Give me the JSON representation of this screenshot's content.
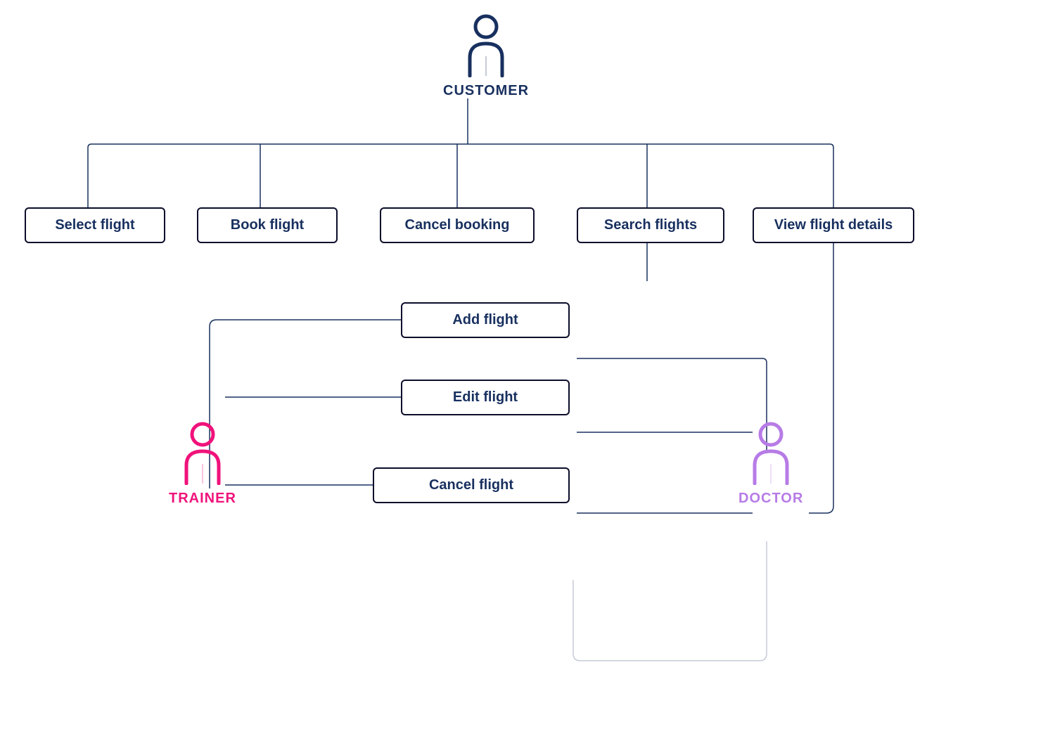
{
  "actors": {
    "customer": {
      "label": "CUSTOMER",
      "color": "#18305f"
    },
    "trainer": {
      "label": "TRAINER",
      "color": "#f0127b"
    },
    "doctor": {
      "label": "DOCTOR",
      "color": "#b77be6"
    }
  },
  "usecases": {
    "select_flight": "Select flight",
    "book_flight": "Book flight",
    "cancel_booking": "Cancel booking",
    "search_flights": "Search flights",
    "view_flight_details": "View flight details",
    "add_flight": "Add flight",
    "edit_flight": "Edit flight",
    "cancel_flight": "Cancel flight"
  }
}
